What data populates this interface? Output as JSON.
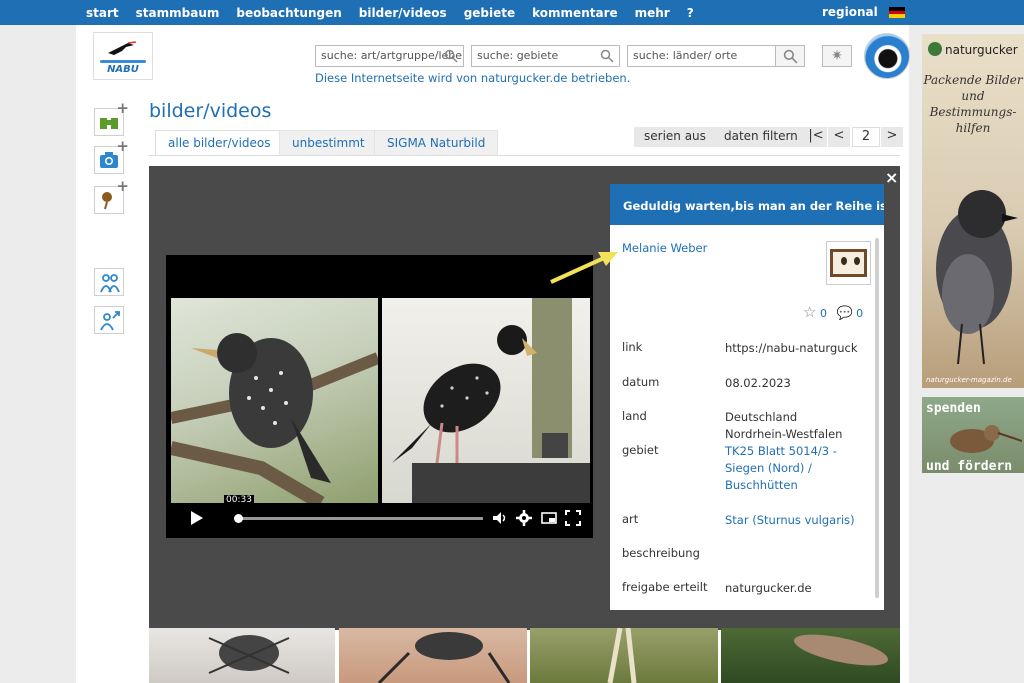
{
  "nav": {
    "items": [
      "start",
      "stammbaum",
      "beobachtungen",
      "bilder/videos",
      "gebiete",
      "kommentare",
      "mehr",
      "?"
    ],
    "regional": "regional"
  },
  "header": {
    "logo_text": "NABU",
    "search_species_placeholder": "suche: art/artgruppe/lebe",
    "search_areas_placeholder": "suche: gebiete",
    "search_places_placeholder": "suche: länder/ orte",
    "operator_text": "Diese Internetseite wird von naturgucker.de betrieben."
  },
  "page": {
    "title": "bilder/videos",
    "tabs": [
      "alle bilder/videos",
      "unbestimmt",
      "SIGMA Naturbild"
    ],
    "toolbar": {
      "series": "serien aus",
      "filter": "daten filtern",
      "first": "|<",
      "prev": "<",
      "page": "2",
      "next": ">"
    }
  },
  "lightbox": {
    "close": "×",
    "video_time": "00:33",
    "info_title": "Geduldig warten,bis man an der Reihe ist...",
    "author": "Melanie Weber",
    "likes": "0",
    "comments": "0",
    "fields": {
      "link_label": "link",
      "link_value": "https://nabu-naturguck",
      "date_label": "datum",
      "date_value": "08.02.2023",
      "country_label": "land",
      "country_value": "Deutschland Nordrhein-Westfalen",
      "area_label": "gebiet",
      "area_value": "TK25 Blatt 5014/3 - Siegen (Nord) / Buschhütten",
      "species_label": "art",
      "species_value": "Star (Sturnus vulgaris)",
      "description_label": "beschreibung",
      "release_label": "freigabe erteilt",
      "release_value": "naturgucker.de"
    }
  },
  "ads": {
    "brand": "naturgucker",
    "claim": "Packende Bilder und Bestimmungs-hilfen",
    "url": "naturgucker-magazin.de",
    "donate_line1": "spenden",
    "donate_line2": "und fördern"
  },
  "colors": {
    "nav_blue": "#1f6fb5",
    "link_blue": "#1f6fb5",
    "lightbox_bg": "#4a4a4a",
    "highlight_arrow": "#f3e15a"
  }
}
